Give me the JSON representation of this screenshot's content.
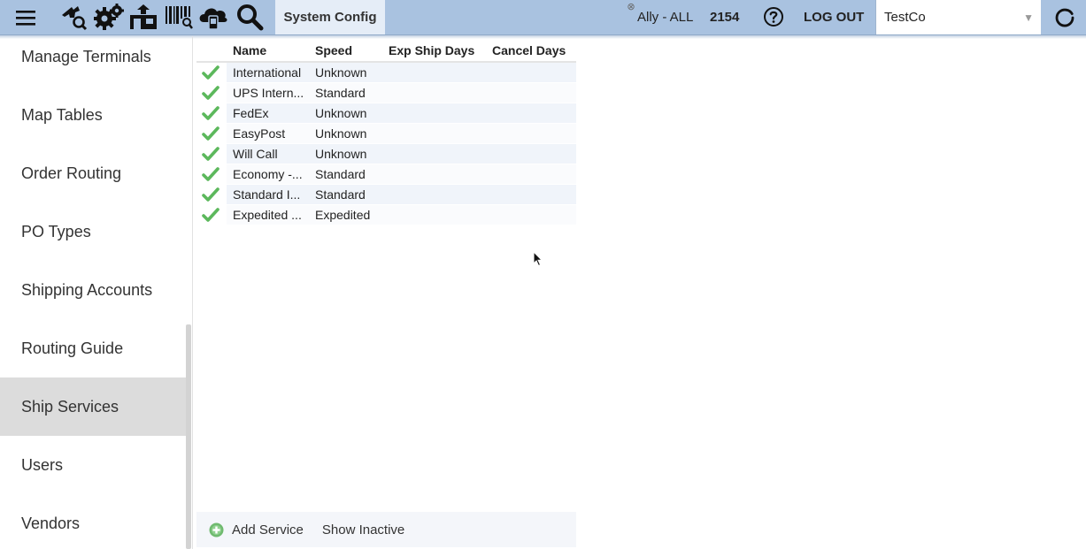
{
  "header": {
    "section_label": "System Config",
    "ally_label": "Ally - ALL",
    "count": "2154",
    "logout_label": "LOG OUT",
    "company_value": "TestCo",
    "company_arrow": "▼",
    "close_glyph": "⊗",
    "icons": [
      "menu-icon",
      "search-user-icon",
      "settings-gears-icon",
      "warehouse-icon",
      "barcode-search-icon",
      "cloud-device-icon",
      "search-icon",
      "help-icon",
      "refresh-icon"
    ]
  },
  "sidebar": {
    "items": [
      {
        "label": "Manage Terminals"
      },
      {
        "label": "Map Tables"
      },
      {
        "label": "Order Routing"
      },
      {
        "label": "PO Types"
      },
      {
        "label": "Shipping Accounts"
      },
      {
        "label": "Routing Guide"
      },
      {
        "label": "Ship Services"
      },
      {
        "label": "Users"
      },
      {
        "label": "Vendors"
      }
    ],
    "active": "Ship Services"
  },
  "grid": {
    "columns": [
      "Name",
      "Speed",
      "Exp Ship Days",
      "Cancel Days"
    ],
    "rows": [
      {
        "name": "International",
        "speed": "Unknown"
      },
      {
        "name": "UPS Intern...",
        "speed": "Standard"
      },
      {
        "name": "FedEx",
        "speed": "Unknown"
      },
      {
        "name": "EasyPost",
        "speed": "Unknown"
      },
      {
        "name": "Will Call",
        "speed": "Unknown"
      },
      {
        "name": "Economy -...",
        "speed": "Standard"
      },
      {
        "name": "Standard I...",
        "speed": "Standard"
      },
      {
        "name": "Expedited ...",
        "speed": "Expedited"
      }
    ]
  },
  "footer": {
    "add_label": "Add Service",
    "show_inactive_label": "Show Inactive"
  },
  "colors": {
    "topbar": "#a9c2e0",
    "active_item": "#dcdcdc",
    "check": "#5cb85c",
    "row_alt": "#f0f4fa"
  }
}
